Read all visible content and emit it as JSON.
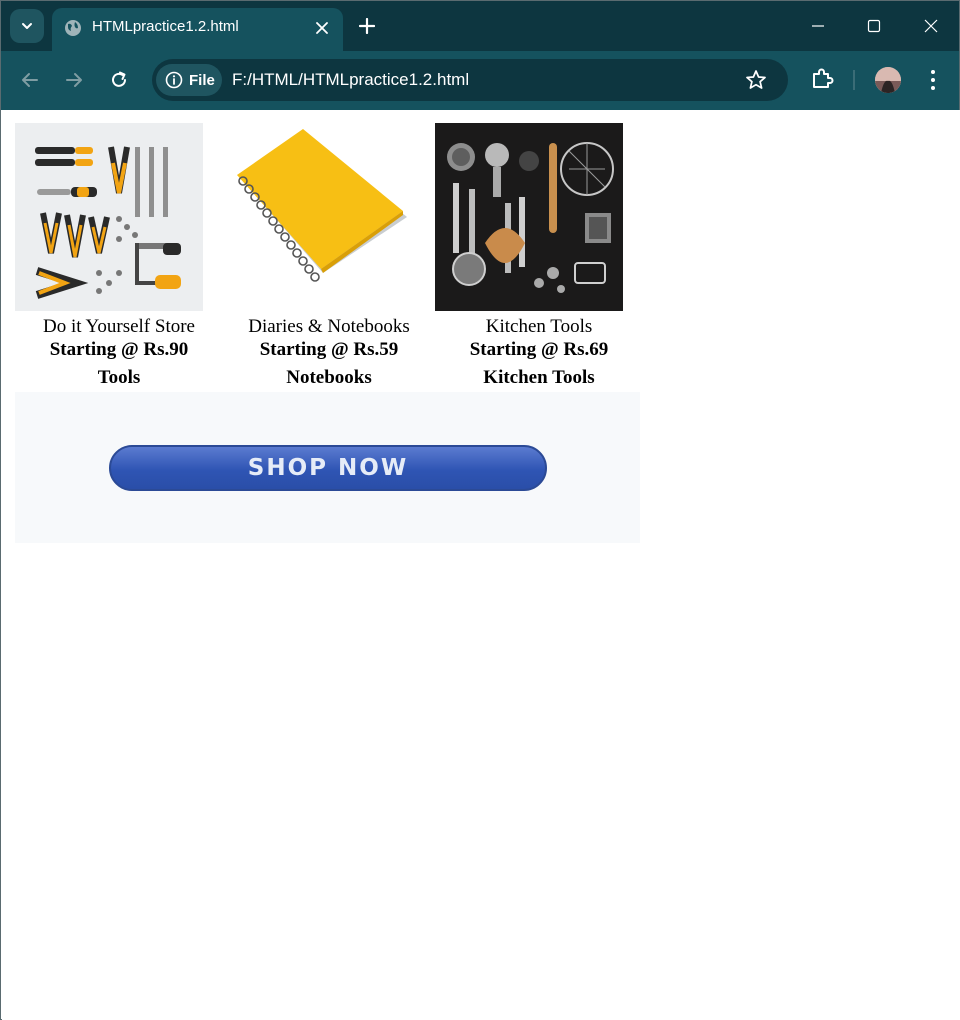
{
  "browser": {
    "tab": {
      "title": "HTMLpractice1.2.html"
    },
    "address": {
      "chip_label": "File",
      "url": "F:/HTML/HTMLpractice1.2.html"
    }
  },
  "products": [
    {
      "name": "Do it Yourself Store",
      "price": "Starting @ Rs.90",
      "category": "Tools",
      "image": "tools-photo"
    },
    {
      "name": "Diaries & Notebooks",
      "price": "Starting @ Rs.59",
      "category": "Notebooks",
      "image": "notebook-photo"
    },
    {
      "name": "Kitchen Tools",
      "price": "Starting @ Rs.69",
      "category": "Kitchen Tools",
      "image": "kitchen-tools-photo"
    }
  ],
  "banner": {
    "button_label": "SHOP NOW"
  },
  "colors": {
    "tabstrip": "#0d3640",
    "toolbar": "#15525e",
    "shop_button": "#2f55b4"
  }
}
